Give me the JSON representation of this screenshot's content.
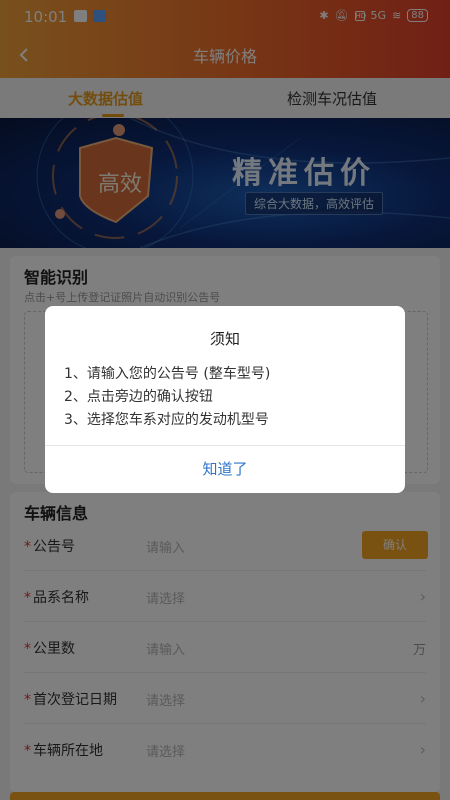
{
  "status_bar": {
    "time": "10:01",
    "network": "5G",
    "hd": "HD",
    "battery": "88"
  },
  "nav": {
    "title": "车辆价格"
  },
  "tabs": [
    {
      "label": "大数据估值",
      "active": true
    },
    {
      "label": "检测车况估值",
      "active": false
    }
  ],
  "banner": {
    "shield_text": "高效",
    "title": "精准估价",
    "subtitle": "综合大数据，高效评估"
  },
  "smart_id": {
    "title": "智能识别",
    "hint": "点击+号上传登记证照片自动识别公告号"
  },
  "vehicle_info": {
    "title": "车辆信息",
    "confirm_label": "确认",
    "rows": [
      {
        "label": "公告号",
        "placeholder": "请输入",
        "trailing": "button"
      },
      {
        "label": "品系名称",
        "placeholder": "请选择",
        "trailing": "chevron"
      },
      {
        "label": "公里数",
        "placeholder": "请输入",
        "trailing": "unit",
        "unit": "万"
      },
      {
        "label": "首次登记日期",
        "placeholder": "请选择",
        "trailing": "chevron"
      },
      {
        "label": "车辆所在地",
        "placeholder": "请选择",
        "trailing": "chevron"
      }
    ]
  },
  "dialog": {
    "title": "须知",
    "lines": [
      "1、请输入您的公告号 (整车型号)",
      "2、点击旁边的确认按钮",
      "3、选择您车系对应的发动机型号"
    ],
    "button": "知道了"
  },
  "colors": {
    "accent": "#f2a423",
    "header_start": "#f0a13a",
    "header_end": "#e2402a",
    "link_blue": "#2f75c8"
  }
}
